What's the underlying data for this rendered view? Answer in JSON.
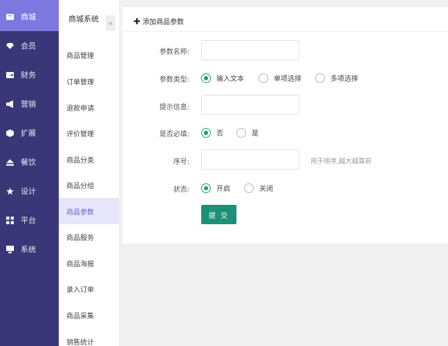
{
  "primary_nav": [
    {
      "label": "商城",
      "icon": "store-icon",
      "active": true
    },
    {
      "label": "会员",
      "icon": "diamond-icon"
    },
    {
      "label": "财务",
      "icon": "wallet-icon"
    },
    {
      "label": "营销",
      "icon": "megaphone-icon"
    },
    {
      "label": "扩展",
      "icon": "cube-icon"
    },
    {
      "label": "餐饮",
      "icon": "eject-icon"
    },
    {
      "label": "设计",
      "icon": "star-icon"
    },
    {
      "label": "平台",
      "icon": "grid-icon"
    },
    {
      "label": "系统",
      "icon": "monitor-icon"
    }
  ],
  "secondary_nav": {
    "title": "商城系统",
    "collapse_glyph": "«",
    "items": [
      "商品管理",
      "订单管理",
      "退款申请",
      "评价管理",
      "商品分类",
      "商品分组",
      "商品参数",
      "商品服务",
      "商品海报",
      "录入订单",
      "商品采集",
      "销售统计"
    ],
    "active_index": 6
  },
  "form": {
    "title": "添加商品参数",
    "name_label": "参数名称:",
    "type_label": "参数类型:",
    "type_options": [
      "输入文本",
      "单项选择",
      "多项选择"
    ],
    "type_selected": 0,
    "hint_label": "提示信息:",
    "required_label": "是否必填:",
    "required_options": [
      "否",
      "是"
    ],
    "required_selected": 0,
    "order_label": "序号:",
    "order_hint": "用于排序,越大越靠前",
    "status_label": "状态:",
    "status_options": [
      "开启",
      "关闭"
    ],
    "status_selected": 0,
    "submit_label": "提 交"
  },
  "colors": {
    "sidebar_bg": "#3a3778",
    "sidebar_active": "#7d78e0",
    "accent_green": "#1d9176"
  }
}
